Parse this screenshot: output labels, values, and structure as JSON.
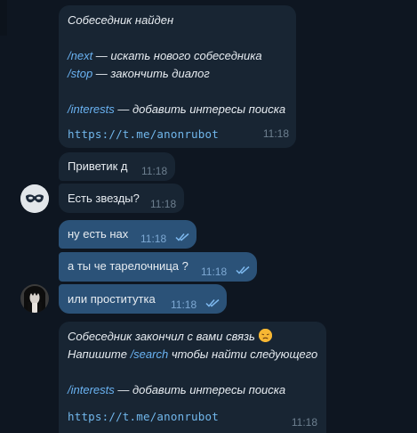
{
  "bot_found": {
    "title": "Собеседник найден",
    "next_cmd": "/next",
    "next_text": " — искать нового собеседника",
    "stop_cmd": "/stop",
    "stop_text": " — закончить диалог",
    "interests_cmd": "/interests",
    "interests_text": " — добавить интересы поиска",
    "link": "https://t.me/anonrubot",
    "time": "11:18"
  },
  "messages": [
    {
      "text": "Приветик д",
      "time": "11:18"
    },
    {
      "text": "Есть звезды?",
      "time": "11:18"
    },
    {
      "text": "ну есть нах",
      "time": "11:18"
    },
    {
      "text": "а ты че тарелочница ?",
      "time": "11:18"
    },
    {
      "text": "или проститутка",
      "time": "11:18"
    }
  ],
  "bot_ended": {
    "line1": "Собеседник закончил с вами связь",
    "line2_prefix": "Напишите ",
    "search_cmd": "/search",
    "line2_suffix": " чтобы найти следующего",
    "interests_cmd": "/interests",
    "interests_text": " — добавить интересы поиска",
    "link": "https://t.me/anonrubot",
    "time": "11:18"
  },
  "icons": {
    "avatar_1": "mask-avatar",
    "avatar_2": "photo-avatar",
    "read": "double-check-icon",
    "emoji": "disappointed-face-emoji"
  },
  "colors": {
    "background": "#0e1621",
    "incoming_bubble": "#182533",
    "outgoing_bubble": "#2b5278",
    "link": "#6ab3f3"
  }
}
